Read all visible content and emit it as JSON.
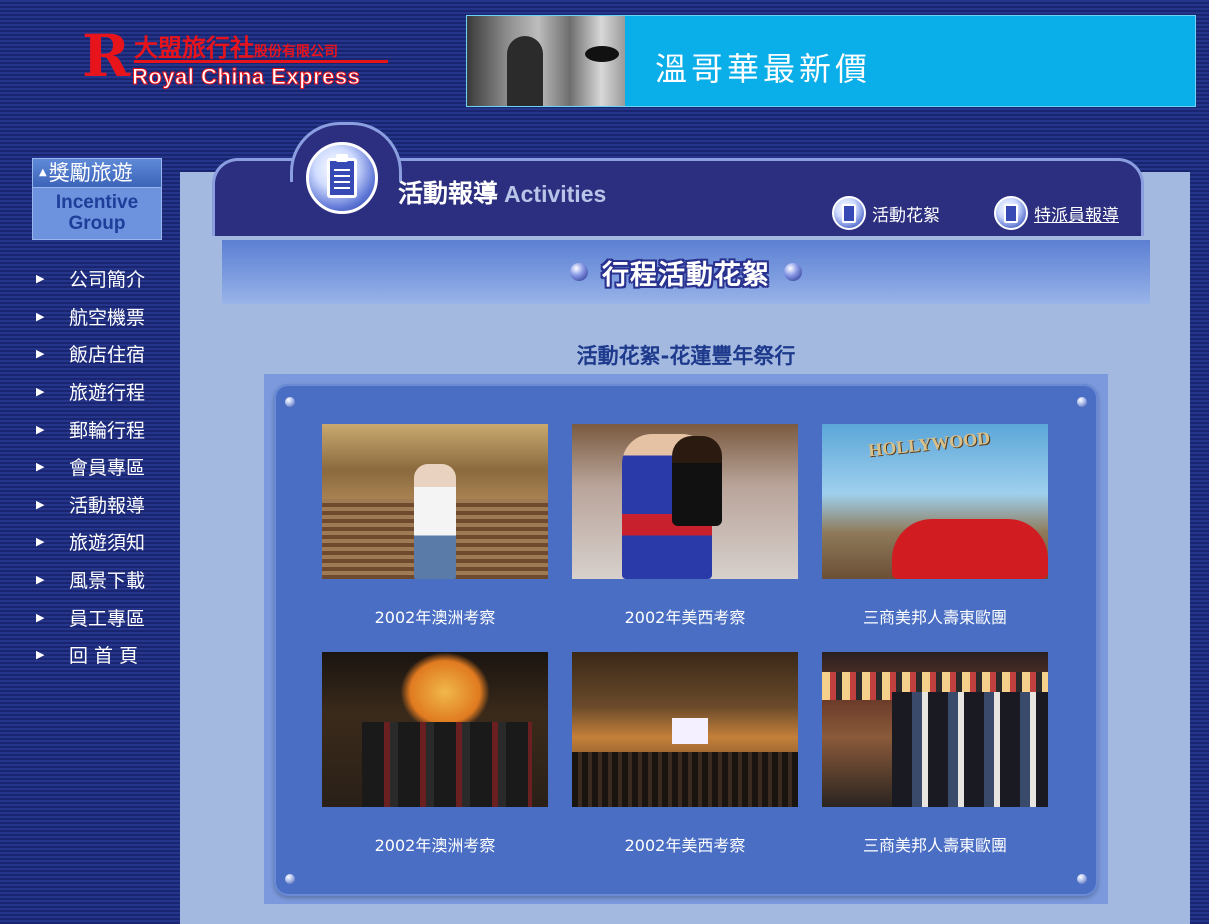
{
  "logo": {
    "cn": "大盟旅行社",
    "cn_suffix": "股份有限公司",
    "en": "Royal China Express"
  },
  "banner": {
    "text": "溫哥華最新價"
  },
  "sidebar": {
    "incentive_cn": "獎勵旅遊",
    "incentive_en_1": "Incentive",
    "incentive_en_2": "Group",
    "menu": [
      "公司簡介",
      "航空機票",
      "飯店住宿",
      "旅遊行程",
      "郵輪行程",
      "會員專區",
      "活動報導",
      "旅遊須知",
      "風景下載",
      "員工專區",
      "回 首 頁"
    ]
  },
  "header": {
    "title_cn": "活動報導",
    "title_en": "Activities",
    "links": [
      "活動花絮",
      "特派員報導"
    ]
  },
  "section": {
    "title": "行程活動花絮"
  },
  "gallery": {
    "title": "活動花絮-花蓮豐年祭行",
    "items": [
      "2002年澳洲考察",
      "2002年美西考察",
      "三商美邦人壽東歐團",
      "2002年澳洲考察",
      "2002年美西考察",
      "三商美邦人壽東歐團"
    ]
  },
  "colors": {
    "background": "#1d2a78",
    "panel": "#a4b9e0",
    "frame": "#4a6ec4",
    "banner": "#0aaee8",
    "brand_red": "#e8141c"
  }
}
